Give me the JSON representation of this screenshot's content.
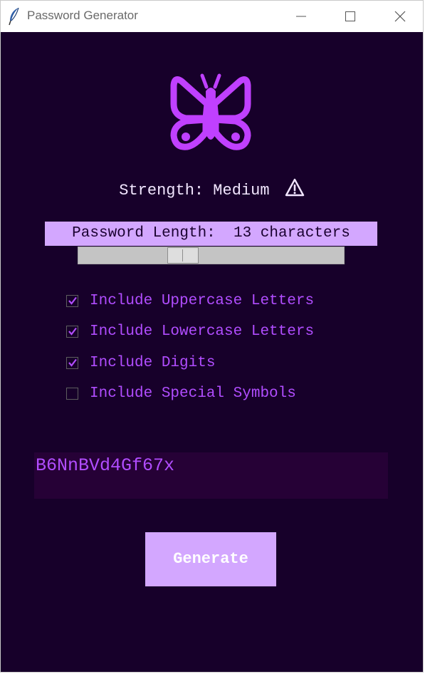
{
  "window": {
    "title": "Password Generator",
    "controls": [
      "minimize-icon",
      "maximize-icon",
      "close-icon"
    ]
  },
  "logo": {
    "icon": "butterfly-icon",
    "color": "#c040ff"
  },
  "strength": {
    "text": "Strength: Medium",
    "icon": "warning-icon"
  },
  "length": {
    "label": "Password Length:  13 characters",
    "value": 13,
    "slider_fraction": 0.38
  },
  "options": [
    {
      "label": "Include Uppercase Letters",
      "checked": true
    },
    {
      "label": "Include Lowercase Letters",
      "checked": true
    },
    {
      "label": "Include Digits",
      "checked": true
    },
    {
      "label": "Include Special Symbols",
      "checked": false
    }
  ],
  "output": {
    "value": "B6NnBVd4Gf67x"
  },
  "generate_button": {
    "label": "Generate"
  },
  "colors": {
    "background": "#17002a",
    "accent": "#d3a7ff",
    "option_text": "#b14dff",
    "output_bg": "#260136"
  }
}
